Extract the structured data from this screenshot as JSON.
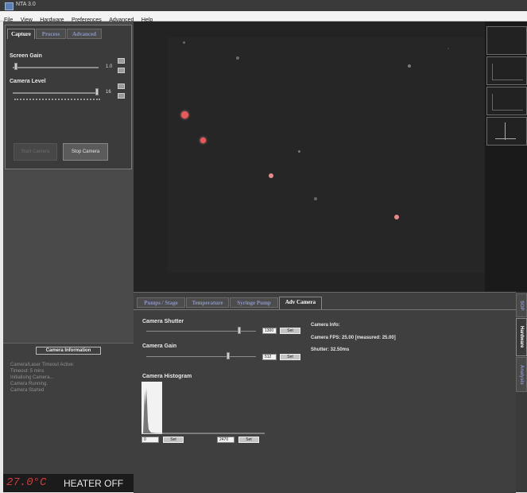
{
  "window": {
    "title": "NTA 3.0"
  },
  "menu": [
    "File",
    "View",
    "Hardware",
    "Preferences",
    "Advanced",
    "Help"
  ],
  "left_tabs": [
    {
      "label": "Capture",
      "active": true
    },
    {
      "label": "Process",
      "active": false
    },
    {
      "label": "Advanced",
      "active": false
    }
  ],
  "screen_gain": {
    "label": "Screen Gain",
    "value": "1.0"
  },
  "camera_level": {
    "label": "Camera Level",
    "value": "16"
  },
  "capture_buttons": {
    "start": "Start Camera",
    "stop": "Stop Camera"
  },
  "camera_info_panel": {
    "title": "Camera Information",
    "lines": [
      "Camera/Laser Timeout Active:",
      "Timeout: 5 mins",
      "Initialising Camera...",
      "Camera Running.",
      "Camera Started"
    ]
  },
  "heater": {
    "temperature": "27.0°C",
    "status": "HEATER OFF"
  },
  "bottom_tabs": [
    {
      "label": "Pumps / Stage",
      "active": false
    },
    {
      "label": "Temperature",
      "active": false
    },
    {
      "label": "Syringe Pump",
      "active": false
    },
    {
      "label": "Adv Camera",
      "active": true
    }
  ],
  "adv_camera": {
    "shutter_label": "Camera Shutter",
    "shutter_value": "1300",
    "gain_label": "Camera Gain",
    "gain_value": "512",
    "set_label": "Set",
    "histogram_label": "Camera Histogram",
    "hist_min": "0",
    "hist_max": "2470",
    "info_title": "Camera Info:",
    "info_fps": "Camera FPS: 25.00 [measured: 25.00]",
    "info_shutter": "Shutter: 32.50ms"
  },
  "side_tabs": [
    "SOP",
    "Hardware",
    "Analysis"
  ],
  "colors": {
    "particle": "#e85a5a",
    "background": "#232323",
    "link_tab": "#8d93c4"
  }
}
